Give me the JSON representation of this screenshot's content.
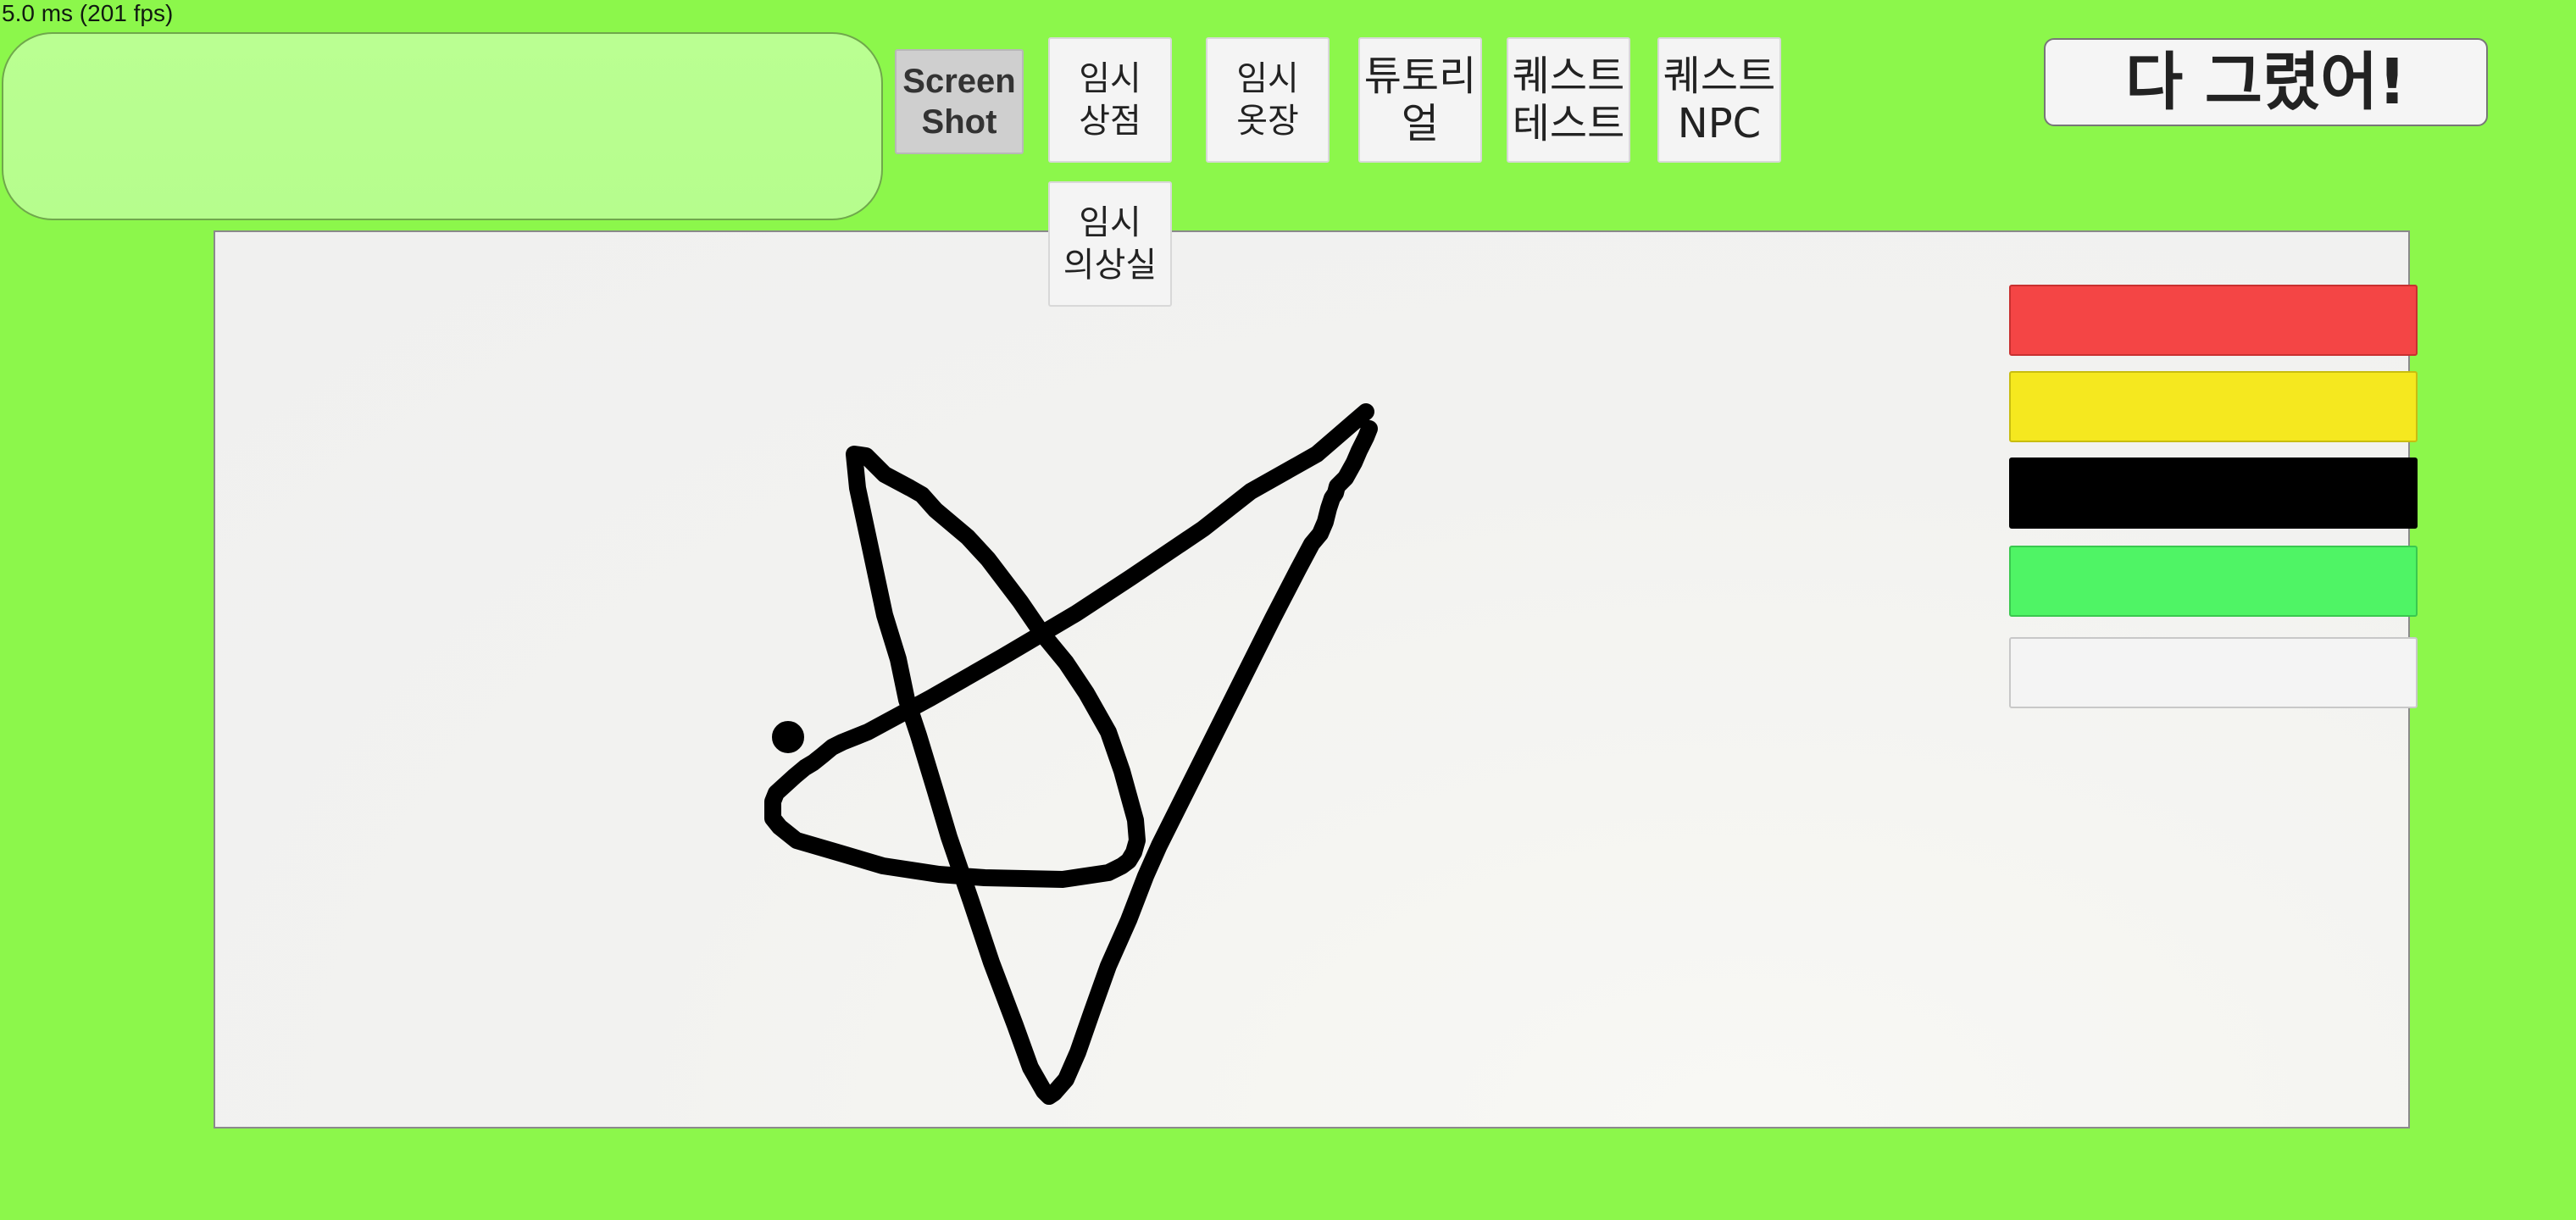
{
  "hud": {
    "fps_text": "5.0 ms (201 fps)"
  },
  "buttons": {
    "screenshot": "Screen\nShot",
    "temp_store": "임시\n상점",
    "temp_closet": "임시\n옷장",
    "tutorial": "튜토리\n얼",
    "quest_test": "퀘스트\n테스트",
    "quest_npc": "퀘스트\nNPC",
    "temp_dressing_room": "임시\n의상실",
    "done": "다 그렸어!"
  },
  "palette": {
    "colors": [
      "#f44545",
      "#f5e81f",
      "#000000",
      "#4ff465",
      "#f4f4f4"
    ]
  },
  "drawing": {
    "stroke_color": "#000000"
  }
}
